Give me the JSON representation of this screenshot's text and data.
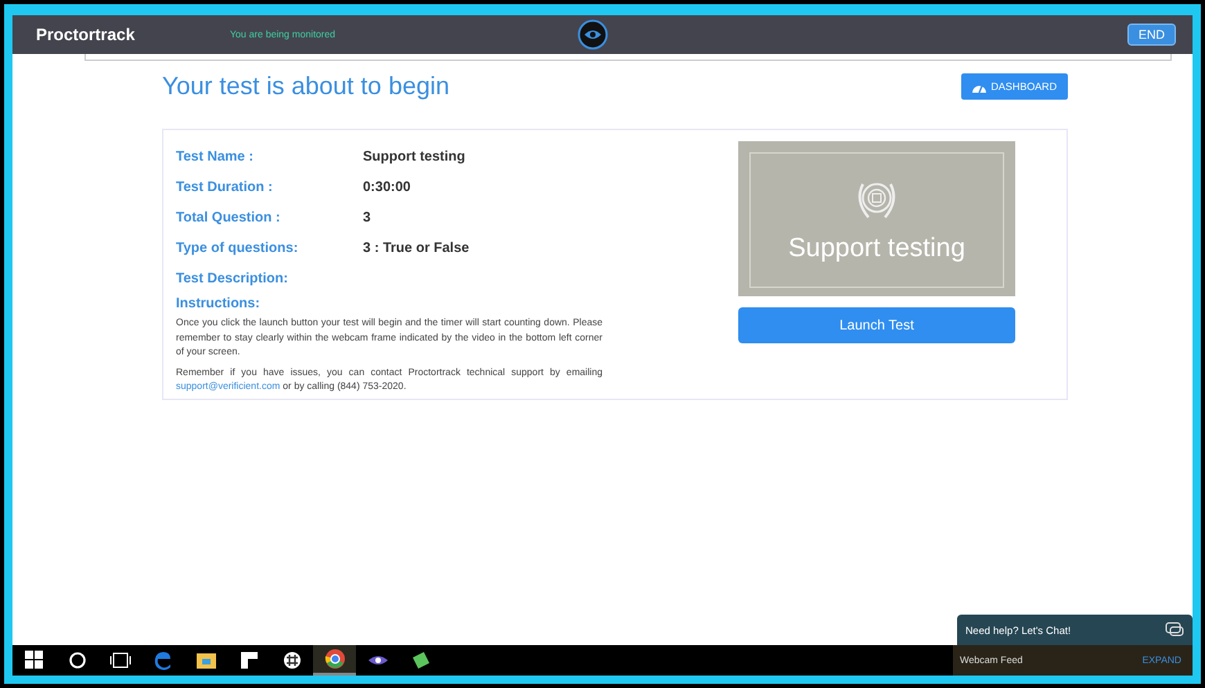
{
  "header": {
    "brand": "Proctortrack",
    "status": "You are being monitored",
    "end_button": "END"
  },
  "page": {
    "title": "Your test is about to begin",
    "dashboard_button": "DASHBOARD"
  },
  "details": [
    {
      "label": "Test Name :",
      "value": "Support testing"
    },
    {
      "label": "Test Duration :",
      "value": "0:30:00"
    },
    {
      "label": "Total Question :",
      "value": "3"
    },
    {
      "label": "Type of questions:",
      "value": "3 : True or False"
    },
    {
      "label": "Test Description:"
    }
  ],
  "instructions": {
    "heading": "Instructions:",
    "paragraph": "Once you click the launch button your test will begin and the timer will start counting down. Please remember to stay clearly within the webcam frame indicated by the video in the bottom left corner of your screen.",
    "contact_before": "Remember if you have issues, you can contact Proctortrack technical support by emailing ",
    "contact_link": "support@verificient.com",
    "contact_after": " or by calling (844) 753-2020."
  },
  "test_card": {
    "title": "Support testing",
    "launch_button": "Launch Test"
  },
  "chat": {
    "label": "Need help? Let's Chat!"
  },
  "webcam": {
    "label": "Webcam Feed",
    "expand": "EXPAND"
  },
  "taskbar": [
    {
      "kind": "start",
      "selected": false
    },
    {
      "kind": "search",
      "selected": false
    },
    {
      "kind": "taskview",
      "selected": false
    },
    {
      "kind": "edge",
      "selected": false
    },
    {
      "kind": "folder",
      "selected": false
    },
    {
      "kind": "store",
      "selected": false
    },
    {
      "kind": "slack",
      "selected": false
    },
    {
      "kind": "chrome",
      "selected": true
    },
    {
      "kind": "eye",
      "selected": false
    },
    {
      "kind": "green",
      "selected": false
    }
  ]
}
